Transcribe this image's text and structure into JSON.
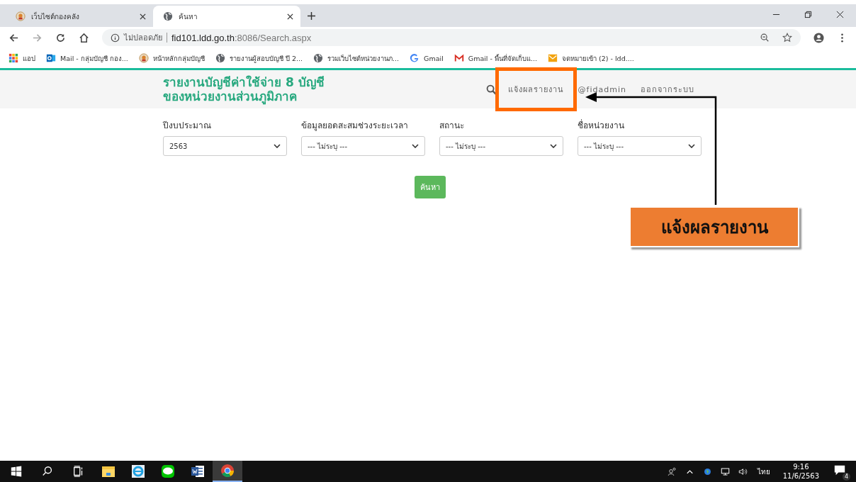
{
  "browser": {
    "tabs": [
      {
        "title": "เว็บไซต์กองคลัง",
        "kind": "seal",
        "selected": false
      },
      {
        "title": "ค้นหา",
        "kind": "globe",
        "selected": true
      }
    ],
    "security_label": "ไม่ปลอดภัย",
    "url_host": "fid101.ldd.go.th",
    "url_rest": ":8086/Search.aspx",
    "bookmarks": [
      {
        "label": "แอป",
        "kind": "apps"
      },
      {
        "label": "Mail - กลุ่มบัญชี กอง...",
        "kind": "outlook"
      },
      {
        "label": "หน้าหลักกลุ่มบัญชี",
        "kind": "seal"
      },
      {
        "label": "รายงานผู้สอบบัญชี ปี 2...",
        "kind": "globe"
      },
      {
        "label": "รวมเว็บไซต์หน่วยงานภ...",
        "kind": "globe"
      },
      {
        "label": "Gmail",
        "kind": "google"
      },
      {
        "label": "Gmail - พื้นที่จัดเก็บแ...",
        "kind": "gmail"
      },
      {
        "label": "จดหมายเข้า (2) - ldd....",
        "kind": "mail"
      }
    ]
  },
  "page": {
    "title": [
      "รายงานบัญชีค่าใช้จ่าย 8 บัญชี",
      "ของหน่วยงานส่วนภูมิภาค"
    ],
    "nav": [
      {
        "label": "แจ้งผลรายงาน",
        "highlighted": true
      },
      {
        "label": "@fidadmin",
        "highlighted": false
      },
      {
        "label": "ออกจากระบบ",
        "highlighted": false
      }
    ],
    "filters": [
      {
        "label": "ปีงบประมาณ",
        "value": "2563"
      },
      {
        "label": "ข้อมูลยอดสะสมช่วงระยะเวลา",
        "value": "--- ไม่ระบุ ---"
      },
      {
        "label": "สถานะ",
        "value": "--- ไม่ระบุ ---"
      },
      {
        "label": "ชื่อหน่วยงาน",
        "value": "--- ไม่ระบุ ---"
      }
    ],
    "search_button": "ค้นหา"
  },
  "callout": {
    "label": "แจ้งผลรายงาน"
  },
  "taskbar": {
    "apps": [
      {
        "kind": "folder",
        "active": false
      },
      {
        "kind": "ie",
        "active": false
      },
      {
        "kind": "line",
        "active": false
      },
      {
        "kind": "word",
        "active": false
      },
      {
        "kind": "chrome",
        "active": true
      }
    ],
    "language": "ไทย",
    "time": "9:16",
    "date": "11/6/2563",
    "notifications": "4"
  }
}
